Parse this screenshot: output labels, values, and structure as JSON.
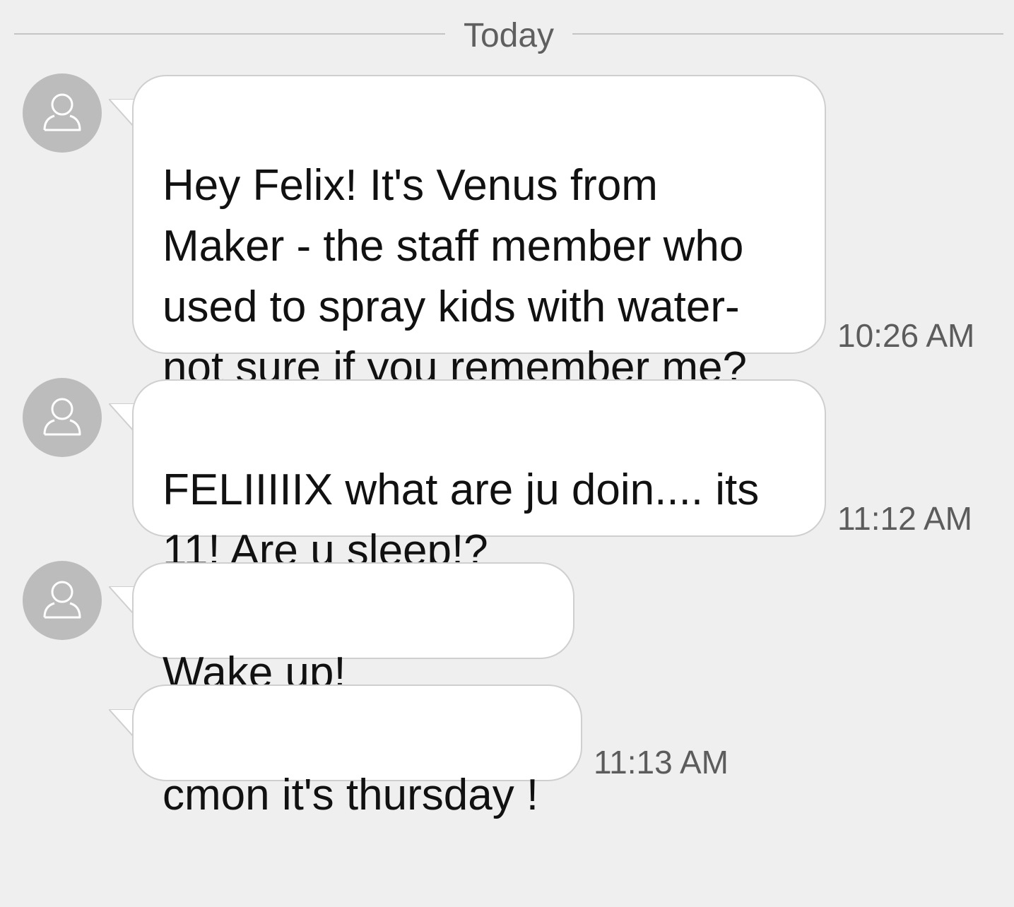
{
  "date_divider": {
    "label": "Today"
  },
  "messages": [
    {
      "text": "Hey Felix! It's Venus from\nMaker - the staff member who\nused to spray kids with water-\nnot sure if you remember me?",
      "time": "10:26 AM",
      "show_avatar": true
    },
    {
      "text": "FELIIIIIX what are ju doin.... its\n11! Are u sleep!?",
      "time": "11:12 AM",
      "show_avatar": true
    },
    {
      "text": "Wake up! LOLOLOL",
      "time": "",
      "show_avatar": true
    },
    {
      "text": "cmon it's thursday !",
      "time": "11:13 AM",
      "show_avatar": false
    }
  ],
  "colors": {
    "background": "#efefef",
    "bubble": "#ffffff",
    "bubble_border": "#cfcfcf",
    "avatar": "#bcbcbc",
    "timestamp": "#5c5c5c"
  },
  "icons": {
    "avatar": "person-outline-icon"
  }
}
